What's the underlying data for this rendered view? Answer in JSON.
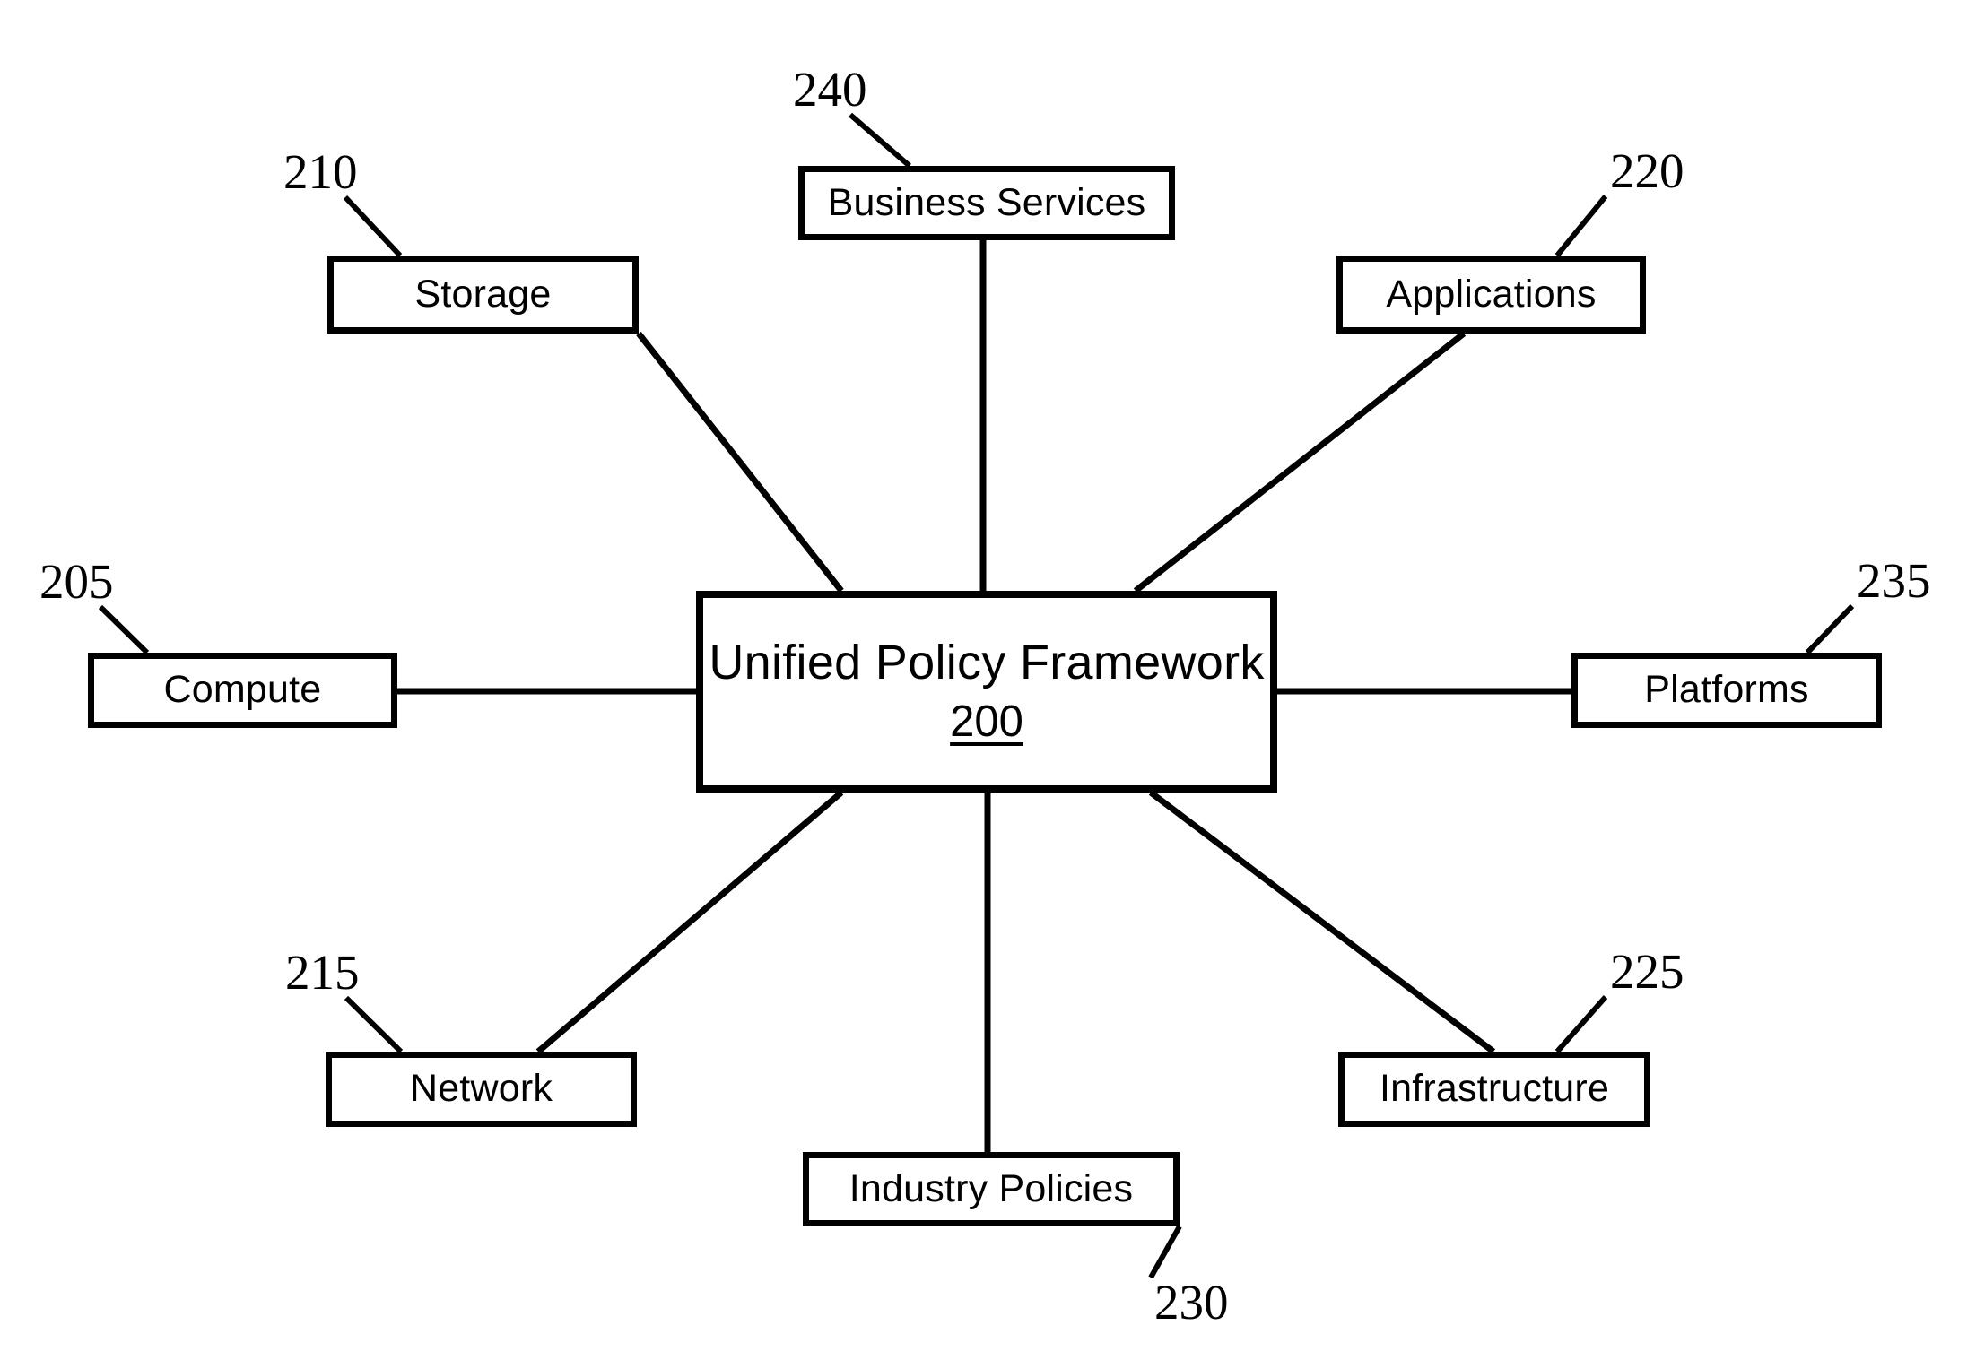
{
  "figure": {
    "title": "Unified Policy Framework hub-and-spoke diagram",
    "line_color": "#000000",
    "background_color": "#ffffff"
  },
  "hub": {
    "title": "Unified Policy Framework",
    "ref": "200"
  },
  "nodes": {
    "compute": {
      "label": "Compute",
      "ref": "205"
    },
    "storage": {
      "label": "Storage",
      "ref": "210"
    },
    "network": {
      "label": "Network",
      "ref": "215"
    },
    "applications": {
      "label": "Applications",
      "ref": "220"
    },
    "infrastructure": {
      "label": "Infrastructure",
      "ref": "225"
    },
    "industry_policies": {
      "label": "Industry Policies",
      "ref": "230"
    },
    "platforms": {
      "label": "Platforms",
      "ref": "235"
    },
    "business_services": {
      "label": "Business Services",
      "ref": "240"
    }
  }
}
